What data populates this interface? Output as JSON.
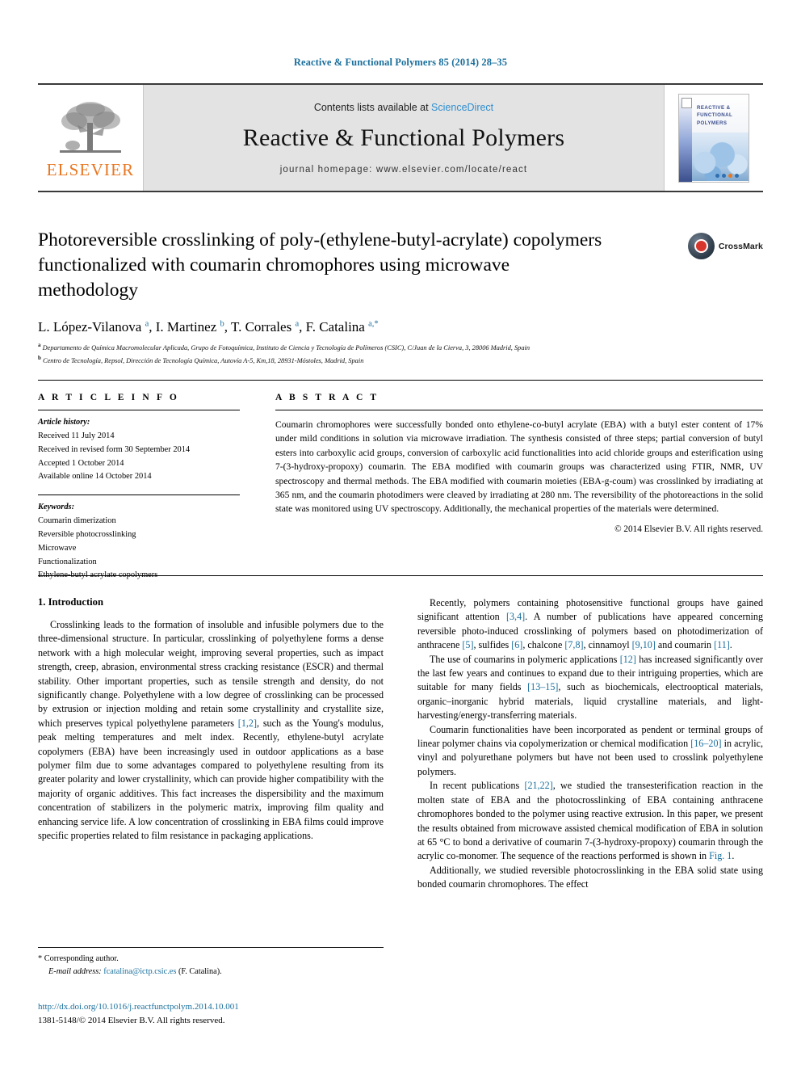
{
  "running_head": "Reactive & Functional Polymers 85 (2014) 28–35",
  "masthead": {
    "contents_prefix": "Contents lists available at ",
    "sciencedirect": "ScienceDirect",
    "journal_title": "Reactive & Functional Polymers",
    "homepage": "journal homepage: www.elsevier.com/locate/react",
    "publisher_name": "ELSEVIER",
    "cover_title_lines": [
      "REACTIVE &",
      "FUNCTIONAL",
      "POLYMERS"
    ]
  },
  "article": {
    "title": "Photoreversible crosslinking of poly-(ethylene-butyl-acrylate) copolymers functionalized with coumarin chromophores using microwave methodology",
    "crossmark_label": "CrossMark",
    "authors_html": "L. López-Vilanova <sup>a</sup>, I. Martinez <sup>b</sup>, T. Corrales <sup>a</sup>, F. Catalina <sup>a,*</sup>",
    "affiliations": [
      "Departamento de Química Macromolecular Aplicada, Grupo de Fotoquímica, Instituto de Ciencia y Tecnología de Polímeros (CSIC), C/Juan de la Cierva, 3, 28006 Madrid, Spain",
      "Centro de Tecnología, Repsol, Dirección de Tecnología Química, Autovía A-5, Km,18, 28931-Móstoles, Madrid, Spain"
    ],
    "affiliation_marks": [
      "a",
      "b"
    ]
  },
  "article_info": {
    "heading": "A R T I C L E  I N F O",
    "history_label": "Article history:",
    "history": [
      "Received 11 July 2014",
      "Received in revised form 30 September 2014",
      "Accepted 1 October 2014",
      "Available online 14 October 2014"
    ],
    "keywords_label": "Keywords:",
    "keywords": [
      "Coumarin dimerization",
      "Reversible photocrosslinking",
      "Microwave",
      "Functionalization",
      "Ethylene-butyl acrylate copolymers"
    ]
  },
  "abstract": {
    "heading": "A B S T R A C T",
    "text": "Coumarin chromophores were successfully bonded onto ethylene-co-butyl acrylate (EBA) with a butyl ester content of 17% under mild conditions in solution via microwave irradiation. The synthesis consisted of three steps; partial conversion of butyl esters into carboxylic acid groups, conversion of carboxylic acid functionalities into acid chloride groups and esterification using 7-(3-hydroxy-propoxy) coumarin. The EBA modified with coumarin groups was characterized using FTIR, NMR, UV spectroscopy and thermal methods. The EBA modified with coumarin moieties (EBA-g-coum) was crosslinked by irradiating at 365 nm, and the coumarin photodimers were cleaved by irradiating at 280 nm. The reversibility of the photoreactions in the solid state was monitored using UV spectroscopy. Additionally, the mechanical properties of the materials were determined.",
    "copyright": "© 2014 Elsevier B.V. All rights reserved."
  },
  "intro": {
    "heading": "1. Introduction",
    "left_paragraphs": [
      "Crosslinking leads to the formation of insoluble and infusible polymers due to the three-dimensional structure. In particular, crosslinking of polyethylene forms a dense network with a high molecular weight, improving several properties, such as impact strength, creep, abrasion, environmental stress cracking resistance (ESCR) and thermal stability. Other important properties, such as tensile strength and density, do not significantly change. Polyethylene with a low degree of crosslinking can be processed by extrusion or injection molding and retain some crystallinity and crystallite size, which preserves typical polyethylene parameters [1,2], such as the Young's modulus, peak melting temperatures and melt index. Recently, ethylene-butyl acrylate copolymers (EBA) have been increasingly used in outdoor applications as a base polymer film due to some advantages compared to polyethylene resulting from its greater polarity and lower crystallinity, which can provide higher compatibility with the majority of organic additives. This fact increases the dispersibility and the maximum concentration of stabilizers in the polymeric matrix, improving film quality and enhancing service life. A low concentration of crosslinking in EBA films could improve specific properties related to film resistance in packaging applications."
    ],
    "right_paragraphs": [
      "Recently, polymers containing photosensitive functional groups have gained significant attention [3,4]. A number of publications have appeared concerning reversible photo-induced crosslinking of polymers based on photodimerization of anthracene [5], sulfides [6], chalcone [7,8], cinnamoyl [9,10] and coumarin [11].",
      "The use of coumarins in polymeric applications [12] has increased significantly over the last few years and continues to expand due to their intriguing properties, which are suitable for many fields [13–15], such as biochemicals, electrooptical materials, organic–inorganic hybrid materials, liquid crystalline materials, and light-harvesting/energy-transferring materials.",
      "Coumarin functionalities have been incorporated as pendent or terminal groups of linear polymer chains via copolymerization or chemical modification [16–20] in acrylic, vinyl and polyurethane polymers but have not been used to crosslink polyethylene polymers.",
      "In recent publications [21,22], we studied the transesterification reaction in the molten state of EBA and the photocrosslinking of EBA containing anthracene chromophores bonded to the polymer using reactive extrusion. In this paper, we present the results obtained from microwave assisted chemical modification of EBA in solution at 65 °C to bond a derivative of coumarin 7-(3-hydroxy-propoxy) coumarin through the acrylic co-monomer. The sequence of the reactions performed is shown in Fig. 1.",
      "Additionally, we studied reversible photocrosslinking in the EBA solid state using bonded coumarin chromophores. The effect"
    ]
  },
  "footnote": {
    "corresponding_mark": "*",
    "corresponding_label": "Corresponding author.",
    "email_label": "E-mail address:",
    "email": "fcatalina@ictp.csic.es",
    "email_suffix": "(F. Catalina)."
  },
  "footer": {
    "doi": "http://dx.doi.org/10.1016/j.reactfunctpolym.2014.10.001",
    "issn_line": "1381-5148/© 2014 Elsevier B.V. All rights reserved."
  },
  "colors": {
    "link_blue": "#1a6f9c",
    "sciencedirect_blue": "#2f8fd0",
    "elsevier_orange": "#E87722",
    "crossmark_red": "#d6362b"
  }
}
